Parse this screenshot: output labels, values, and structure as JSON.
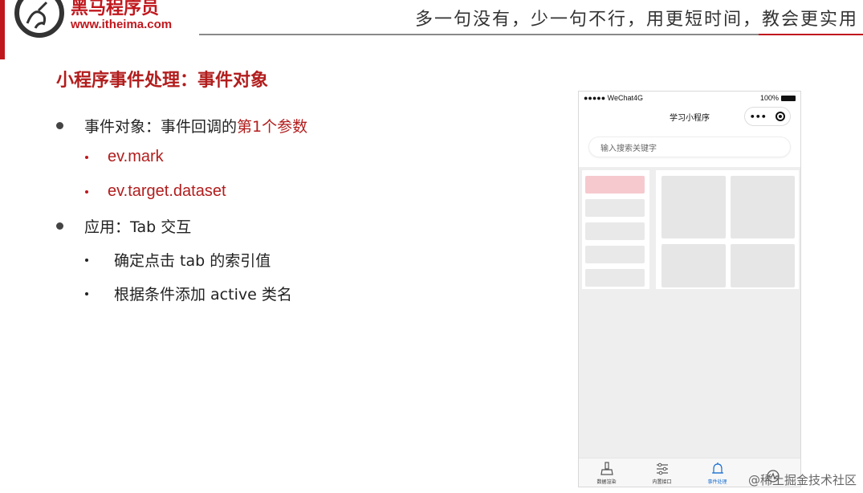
{
  "header": {
    "brand_name": "黑马程序员",
    "brand_url": "www.itheima.com",
    "slogan": "多一句没有，少一句不行，用更短时间，教会更实用",
    "accent_color": "#c0171d"
  },
  "slide": {
    "title": "小程序事件处理：事件对象",
    "bullets": [
      {
        "text": "事件对象：事件回调的",
        "highlight": "第1个参数",
        "subitems": [
          "ev.mark",
          "ev.target.dataset"
        ]
      },
      {
        "text": "应用：Tab 交互",
        "subitems": [
          "确定点击 tab 的索引值",
          "根据条件添加 active 类名"
        ]
      }
    ]
  },
  "phone": {
    "status_left": "●●●●● WeChat4G",
    "status_right": "100%",
    "nav_title": "学习小程序",
    "capsule_dots": "•••",
    "search_placeholder": "输入搜索关键字",
    "active_tab_color": "#1a6fd1",
    "active_side_color": "#f6c9ce",
    "tabs": [
      {
        "label": "数据渲染",
        "icon": "broom-icon"
      },
      {
        "label": "内置接口",
        "icon": "sliders-icon"
      },
      {
        "label": "事件处理",
        "icon": "bell-icon"
      },
      {
        "label": "",
        "icon": "chart-icon"
      }
    ]
  },
  "watermark": "@稀土掘金技术社区"
}
